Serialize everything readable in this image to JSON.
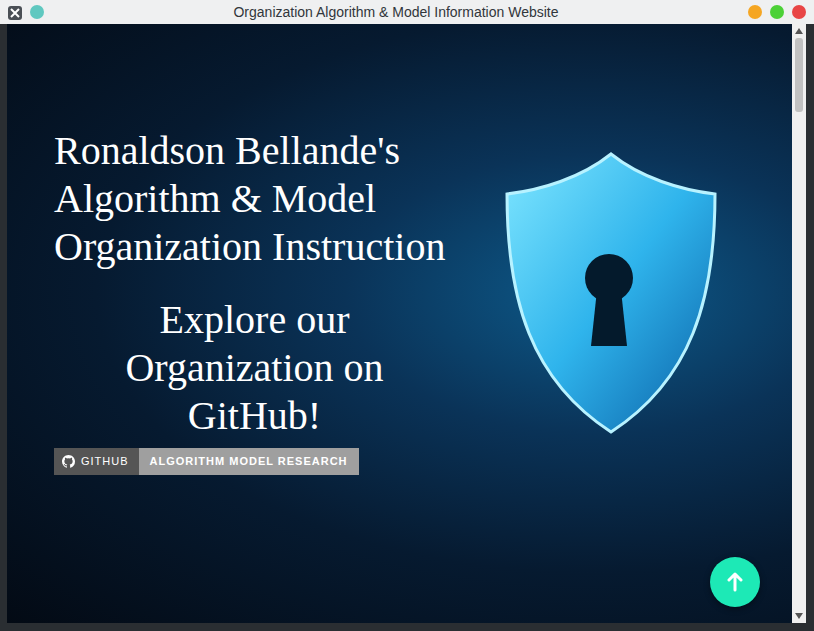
{
  "window": {
    "title": "Organization Algorithm & Model Information Website"
  },
  "hero": {
    "heading": "Ronaldson Bellande's Algorithm & Model Organization Instruction",
    "subheading": "Explore our Organization on GitHub!"
  },
  "badge": {
    "label": "GITHUB",
    "message": "ALGORITHM MODEL RESEARCH"
  },
  "scrollbar": {
    "level": 0.13
  }
}
